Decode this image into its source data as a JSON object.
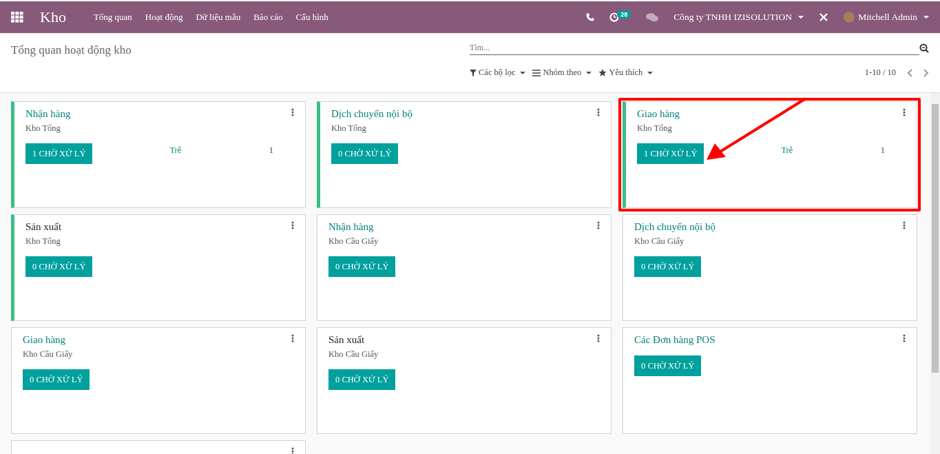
{
  "navbar": {
    "app_name": "Kho",
    "menu": [
      "Tổng quan",
      "Hoạt động",
      "Dữ liệu mẫu",
      "Báo cáo",
      "Cấu hình"
    ],
    "activity_count": "28",
    "company": "Công ty TNHH IZISOLUTION",
    "user": "Mitchell Admin"
  },
  "control_panel": {
    "title": "Tổng quan hoạt động kho",
    "search": {
      "placeholder": "Tìm..."
    },
    "filters": [
      "Các bộ lọc",
      "Nhóm theo",
      "Yêu thích"
    ],
    "pager": "1-10 / 10"
  },
  "cards": [
    {
      "title": "Nhận hàng",
      "warehouse": "Kho Tổng",
      "button": "1 CHỜ XỬ LÝ",
      "late_label": "Trễ",
      "late_count": "1",
      "color": "#3cbd84",
      "linked": true,
      "highlighted": false
    },
    {
      "title": "Dịch chuyển nội bộ",
      "warehouse": "Kho Tổng",
      "button": "0 CHỜ XỬ LÝ",
      "color": "#3cbd84",
      "linked": true,
      "highlighted": false
    },
    {
      "title": "Giao hàng",
      "warehouse": "Kho Tổng",
      "button": "1 CHỜ XỬ LÝ",
      "late_label": "Trễ",
      "late_count": "1",
      "color": "#3cbd84",
      "linked": true,
      "highlighted": true
    },
    {
      "title": "Sản xuất",
      "warehouse": "Kho Tổng",
      "button": "0 CHỜ XỬ LÝ",
      "color": "#3cbd84",
      "linked": false,
      "highlighted": false
    },
    {
      "title": "Nhận hàng",
      "warehouse": "Kho Cầu Giấy",
      "button": "0 CHỜ XỬ LÝ",
      "linked": true,
      "highlighted": false
    },
    {
      "title": "Dịch chuyển nội bộ",
      "warehouse": "Kho Cầu Giấy",
      "button": "0 CHỜ XỬ LÝ",
      "linked": true,
      "highlighted": false
    },
    {
      "title": "Giao hàng",
      "warehouse": "Kho Cầu Giấy",
      "button": "0 CHỜ XỬ LÝ",
      "linked": true,
      "highlighted": false
    },
    {
      "title": "Sản xuất",
      "warehouse": "Kho Cầu Giấy",
      "button": "0 CHỜ XỬ LÝ",
      "linked": false,
      "highlighted": false
    },
    {
      "title": "Các Đơn hàng POS",
      "button": "0 CHỜ XỬ LÝ",
      "linked": true,
      "highlighted": false
    },
    {
      "highlighted": false
    }
  ]
}
